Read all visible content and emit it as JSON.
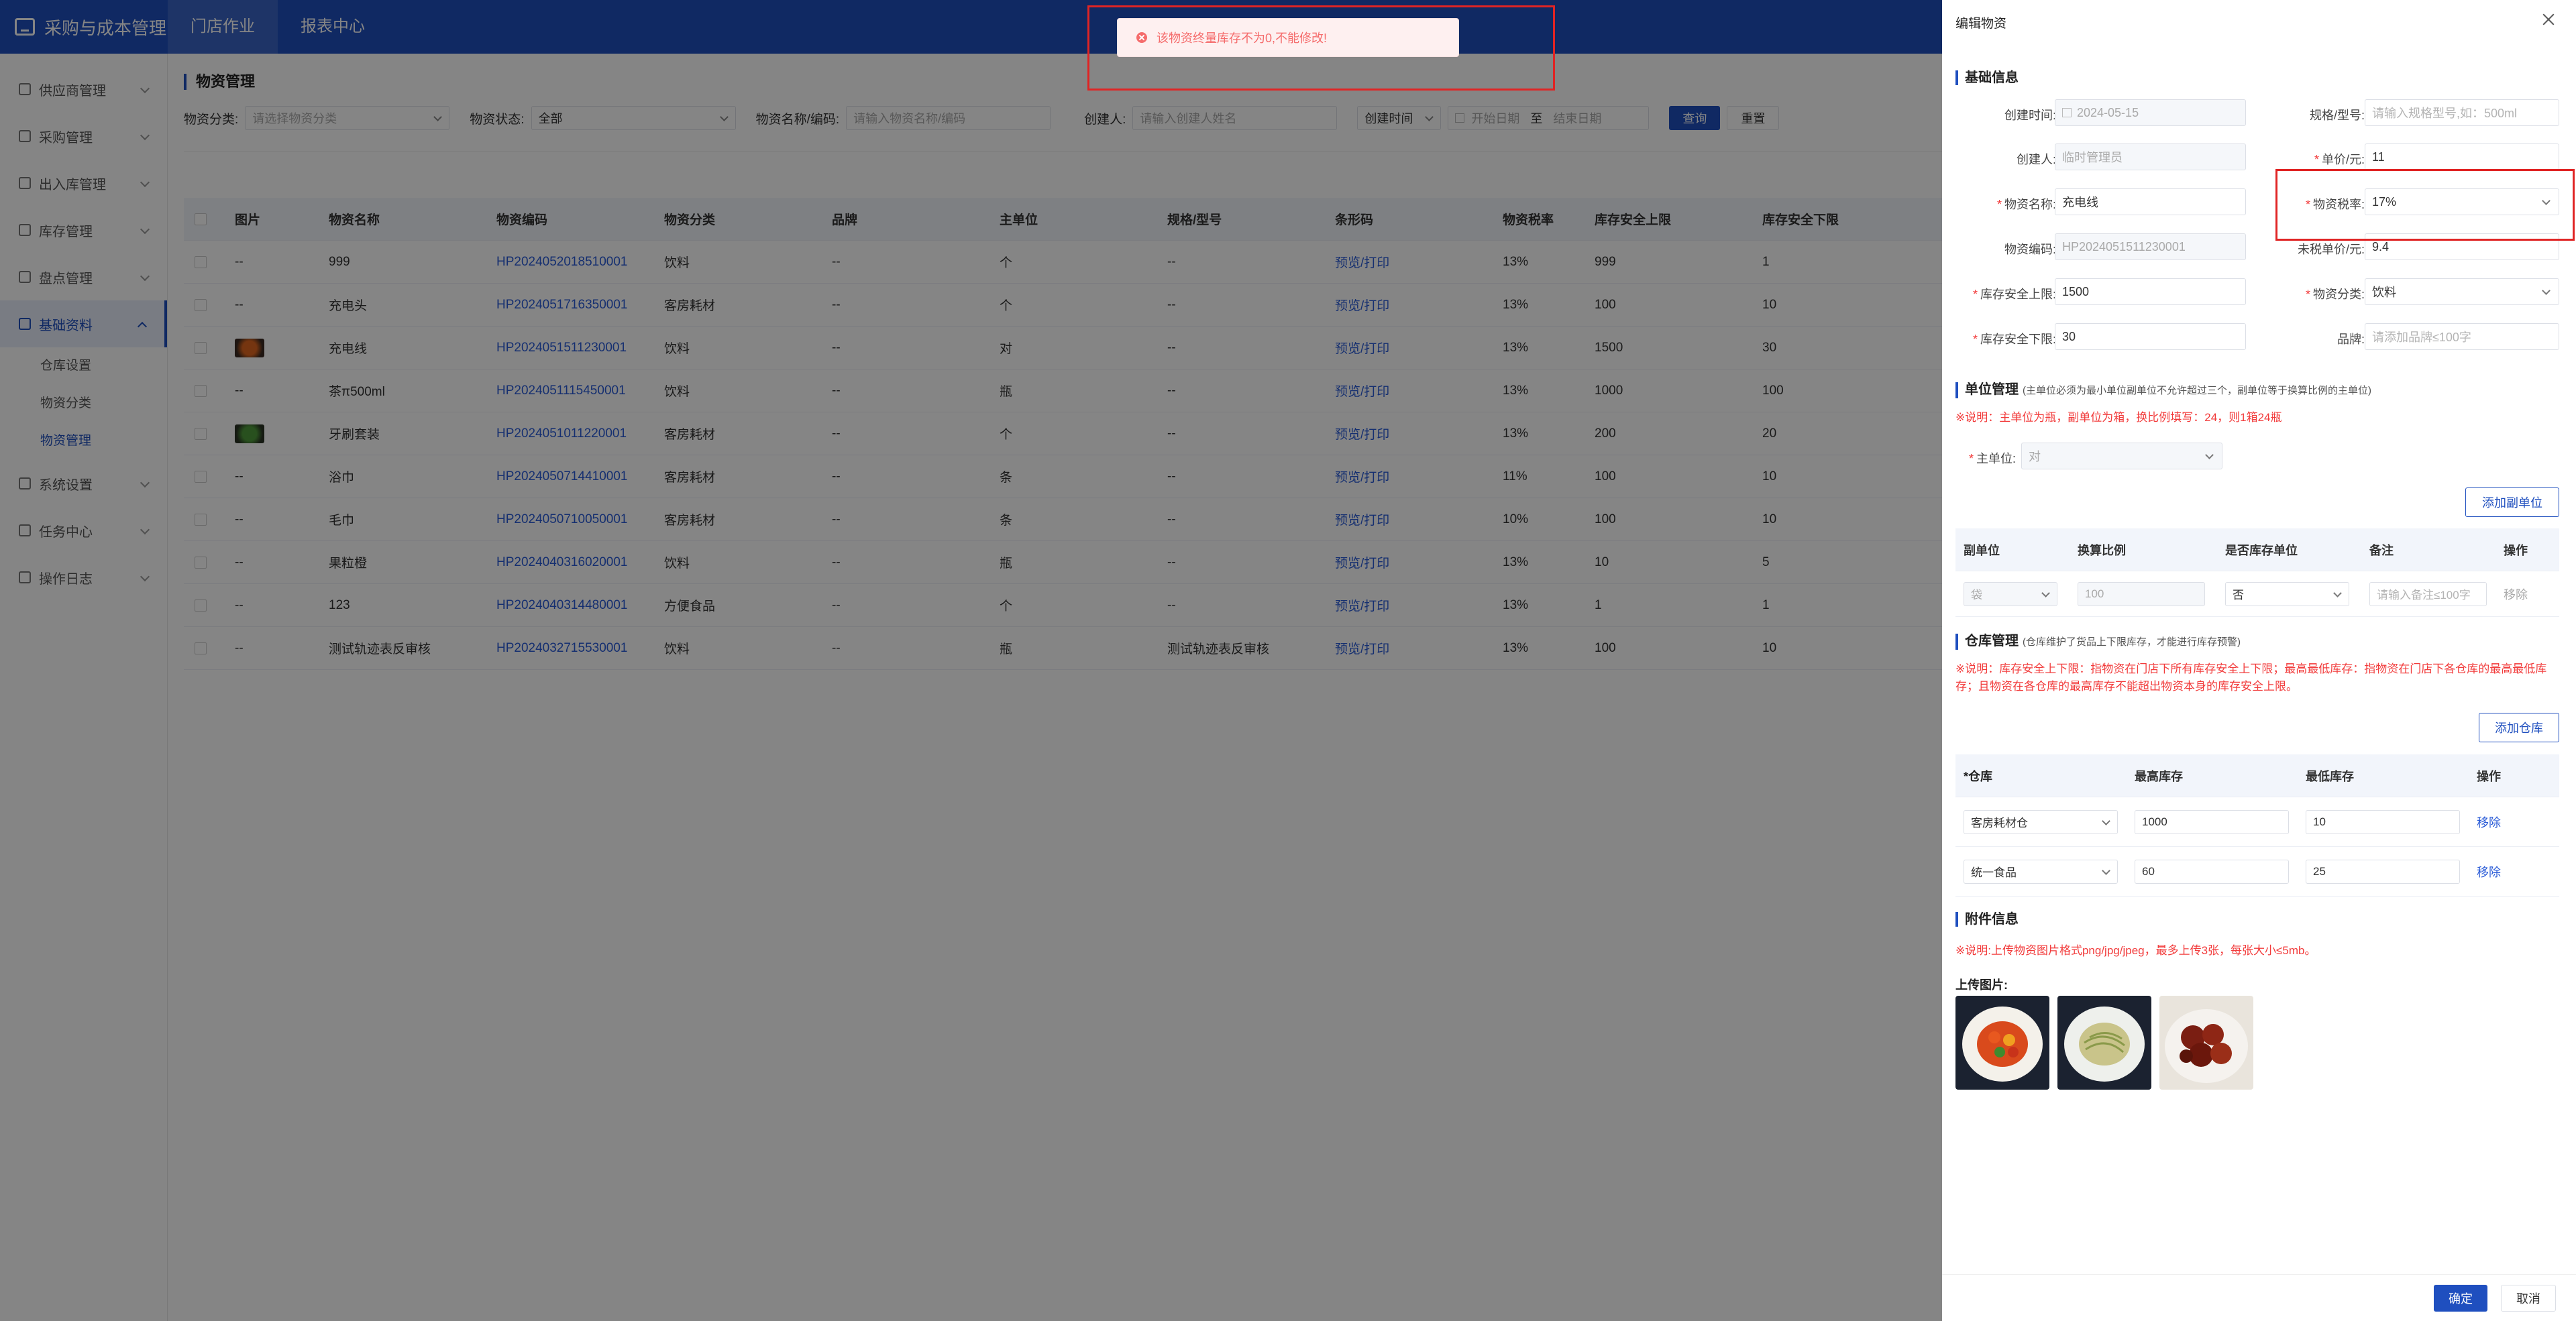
{
  "app": {
    "title": "采购与成本管理",
    "nav": [
      "门店作业",
      "报表中心"
    ]
  },
  "sidebar": {
    "items": [
      {
        "label": "供应商管理",
        "icon": "supplier-icon"
      },
      {
        "label": "采购管理",
        "icon": "cart-icon"
      },
      {
        "label": "出入库管理",
        "icon": "inout-icon"
      },
      {
        "label": "库存管理",
        "icon": "stock-icon"
      },
      {
        "label": "盘点管理",
        "icon": "check-icon"
      },
      {
        "label": "基础资料",
        "icon": "database-icon"
      },
      {
        "label": "系统设置",
        "icon": "gear-icon"
      },
      {
        "label": "任务中心",
        "icon": "task-icon"
      },
      {
        "label": "操作日志",
        "icon": "log-icon"
      }
    ],
    "sub": [
      "仓库设置",
      "物资分类",
      "物资管理"
    ]
  },
  "page": {
    "title": "物资管理"
  },
  "filter": {
    "category_label": "物资分类:",
    "category_ph": "请选择物资分类",
    "status_label": "物资状态:",
    "status_val": "全部",
    "name_label": "物资名称/编码:",
    "name_ph": "请输入物资名称/编码",
    "creator_label": "创建人:",
    "creator_ph": "请输入创建人姓名",
    "time_type": "创建时间",
    "start_ph": "开始日期",
    "sep": "至",
    "end_ph": "结束日期",
    "query": "查询",
    "reset": "重置"
  },
  "table": {
    "headers": [
      "图片",
      "物资名称",
      "物资编码",
      "物资分类",
      "品牌",
      "主单位",
      "规格/型号",
      "条形码",
      "物资税率",
      "库存安全上限",
      "库存安全下限"
    ],
    "rows": [
      {
        "pic": "--",
        "name": "999",
        "code": "HP2024052018510001",
        "cat": "饮料",
        "brand": "--",
        "unit": "个",
        "spec": "--",
        "barcode": "预览/打印",
        "tax": "13%",
        "upper": "999",
        "lower": "1"
      },
      {
        "pic": "--",
        "name": "充电头",
        "code": "HP2024051716350001",
        "cat": "客房耗材",
        "brand": "--",
        "unit": "个",
        "spec": "--",
        "barcode": "预览/打印",
        "tax": "13%",
        "upper": "100",
        "lower": "10"
      },
      {
        "pic": "img-tomato",
        "name": "充电线",
        "code": "HP2024051511230001",
        "cat": "饮料",
        "brand": "--",
        "unit": "对",
        "spec": "--",
        "barcode": "预览/打印",
        "tax": "13%",
        "upper": "1500",
        "lower": "30"
      },
      {
        "pic": "--",
        "name": "茶π500ml",
        "code": "HP2024051115450001",
        "cat": "饮料",
        "brand": "--",
        "unit": "瓶",
        "spec": "--",
        "barcode": "预览/打印",
        "tax": "13%",
        "upper": "1000",
        "lower": "100"
      },
      {
        "pic": "img-greens",
        "name": "牙刷套装",
        "code": "HP2024051011220001",
        "cat": "客房耗材",
        "brand": "--",
        "unit": "个",
        "spec": "--",
        "barcode": "预览/打印",
        "tax": "13%",
        "upper": "200",
        "lower": "20"
      },
      {
        "pic": "--",
        "name": "浴巾",
        "code": "HP2024050714410001",
        "cat": "客房耗材",
        "brand": "--",
        "unit": "条",
        "spec": "--",
        "barcode": "预览/打印",
        "tax": "11%",
        "upper": "100",
        "lower": "10"
      },
      {
        "pic": "--",
        "name": "毛巾",
        "code": "HP2024050710050001",
        "cat": "客房耗材",
        "brand": "--",
        "unit": "条",
        "spec": "--",
        "barcode": "预览/打印",
        "tax": "10%",
        "upper": "100",
        "lower": "10"
      },
      {
        "pic": "--",
        "name": "果粒橙",
        "code": "HP2024040316020001",
        "cat": "饮料",
        "brand": "--",
        "unit": "瓶",
        "spec": "--",
        "barcode": "预览/打印",
        "tax": "13%",
        "upper": "10",
        "lower": "5"
      },
      {
        "pic": "--",
        "name": "123",
        "code": "HP2024040314480001",
        "cat": "方便食品",
        "brand": "--",
        "unit": "个",
        "spec": "--",
        "barcode": "预览/打印",
        "tax": "13%",
        "upper": "1",
        "lower": "1"
      },
      {
        "pic": "--",
        "name": "测试轨迹表反审核",
        "code": "HP2024032715530001",
        "cat": "饮料",
        "brand": "--",
        "unit": "瓶",
        "spec": "测试轨迹表反审核",
        "barcode": "预览/打印",
        "tax": "13%",
        "upper": "100",
        "lower": "10"
      }
    ]
  },
  "toast": {
    "text": "该物资终量库存不为0,不能修改!"
  },
  "drawer": {
    "title": "编辑物资",
    "basic": {
      "title": "基础信息",
      "created_time_label": "创建时间:",
      "created_time": "2024-05-15",
      "spec_label": "规格/型号:",
      "spec_ph": "请输入规格型号,如：500ml",
      "creator_label": "创建人:",
      "creator": "临时管理员",
      "price_label": "单价/元:",
      "price": "11",
      "name_label": "物资名称:",
      "name": "充电线",
      "tax_label": "物资税率:",
      "tax": "17%",
      "code_label": "物资编码:",
      "code": "HP2024051511230001",
      "notax_label": "未税单价/元:",
      "notax": "9.4",
      "upper_label": "库存安全上限:",
      "upper": "1500",
      "cat_label": "物资分类:",
      "cat": "饮料",
      "lower_label": "库存安全下限:",
      "lower": "30",
      "brand_label": "品牌:",
      "brand_ph": "请添加品牌≤100字"
    },
    "unit": {
      "title": "单位管理",
      "note": "(主单位必须为最小单位副单位不允许超过三个，副单位等于换算比例的主单位)",
      "tip": "※说明：主单位为瓶，副单位为箱，换比例填写：24，则1箱24瓶",
      "main_label": "主单位:",
      "main_val": "对",
      "add": "添加副单位",
      "headers": [
        "副单位",
        "换算比例",
        "是否库存单位",
        "备注",
        "操作"
      ],
      "row": {
        "unit": "袋",
        "ratio": "100",
        "is_stock": "否",
        "remark_ph": "请输入备注≤100字",
        "op": "移除"
      }
    },
    "warehouse": {
      "title": "仓库管理",
      "note": "(仓库维护了货品上下限库存，才能进行库存预警)",
      "tip": "※说明：库存安全上下限：指物资在门店下所有库存安全上下限；最高最低库存：指物资在门店下各仓库的最高最低库存；且物资在各仓库的最高库存不能超出物资本身的库存安全上限。",
      "add": "添加仓库",
      "headers": [
        "*仓库",
        "最高库存",
        "最低库存",
        "操作"
      ],
      "rows": [
        {
          "wh": "客房耗材仓",
          "max": "1000",
          "min": "10",
          "op": "移除"
        },
        {
          "wh": "统一食品",
          "max": "60",
          "min": "25",
          "op": "移除"
        }
      ]
    },
    "attach": {
      "title": "附件信息",
      "tip": "※说明:上传物资图片格式png/jpg/jpeg，最多上传3张，每张大小≤5mb。",
      "upload_label": "上传图片:"
    },
    "footer": {
      "ok": "确定",
      "cancel": "取消"
    }
  }
}
